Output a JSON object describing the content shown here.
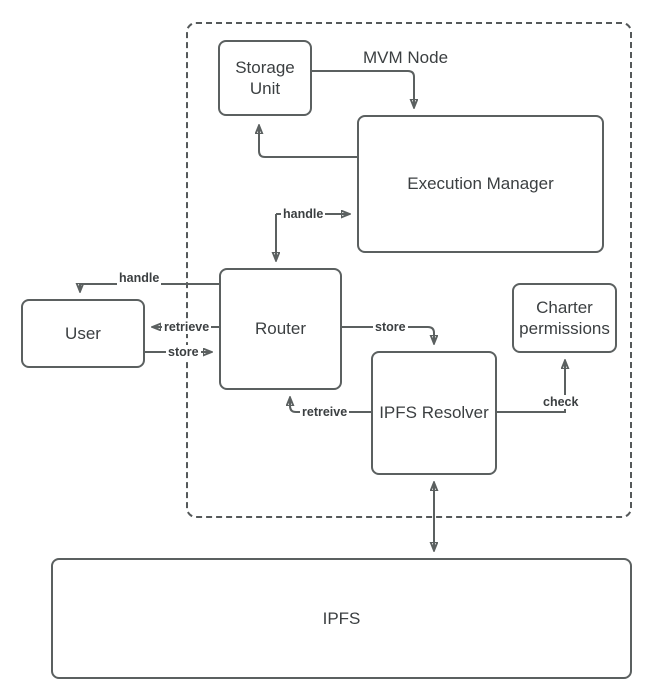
{
  "diagram": {
    "title_label": "MVM Node",
    "colors": {
      "stroke": "#5b6060",
      "text": "#3b3f41",
      "background": "#ffffff"
    },
    "nodes": {
      "storage_unit": "Storage\nUnit",
      "execution_manager": "Execution Manager",
      "router": "Router",
      "user": "User",
      "ipfs_resolver": "IPFS Resolver",
      "charter_permissions": "Charter\npermissions",
      "ipfs": "IPFS"
    },
    "edges": {
      "handle_user": "handle",
      "retrieve_user": "retrieve",
      "store_user": "store",
      "handle_exec": "handle",
      "store_resolver": "store",
      "retreive_router": "retreive",
      "check_charter": "check"
    }
  }
}
